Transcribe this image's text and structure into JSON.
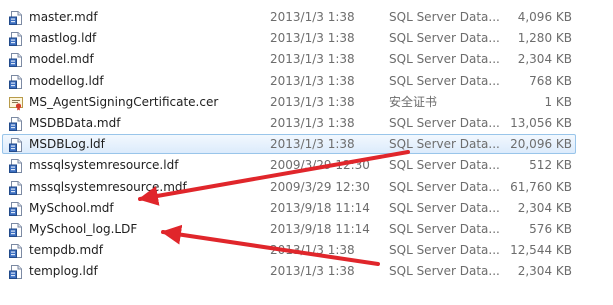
{
  "files": [
    {
      "name": "master.mdf",
      "date": "2013/1/3 1:38",
      "type": "SQL Server Data...",
      "size": "4,096 KB",
      "icon": "sql-data-file-icon"
    },
    {
      "name": "mastlog.ldf",
      "date": "2013/1/3 1:38",
      "type": "SQL Server Data...",
      "size": "1,280 KB",
      "icon": "sql-data-file-icon"
    },
    {
      "name": "model.mdf",
      "date": "2013/1/3 1:38",
      "type": "SQL Server Data...",
      "size": "2,304 KB",
      "icon": "sql-data-file-icon"
    },
    {
      "name": "modellog.ldf",
      "date": "2013/1/3 1:38",
      "type": "SQL Server Data...",
      "size": "768 KB",
      "icon": "sql-data-file-icon"
    },
    {
      "name": "MS_AgentSigningCertificate.cer",
      "date": "2013/1/3 1:38",
      "type": "安全证书",
      "size": "1 KB",
      "icon": "certificate-icon"
    },
    {
      "name": "MSDBData.mdf",
      "date": "2013/1/3 1:38",
      "type": "SQL Server Data...",
      "size": "13,056 KB",
      "icon": "sql-data-file-icon"
    },
    {
      "name": "MSDBLog.ldf",
      "date": "2013/1/3 1:38",
      "type": "SQL Server Data...",
      "size": "20,096 KB",
      "icon": "sql-data-file-icon",
      "selected": true
    },
    {
      "name": "mssqlsystemresource.ldf",
      "date": "2009/3/29 12:30",
      "type": "SQL Server Data...",
      "size": "512 KB",
      "icon": "sql-data-file-icon"
    },
    {
      "name": "mssqlsystemresource.mdf",
      "date": "2009/3/29 12:30",
      "type": "SQL Server Data...",
      "size": "61,760 KB",
      "icon": "sql-data-file-icon"
    },
    {
      "name": "MySchool.mdf",
      "date": "2013/9/18 11:14",
      "type": "SQL Server Data...",
      "size": "2,304 KB",
      "icon": "sql-data-file-icon"
    },
    {
      "name": "MySchool_log.LDF",
      "date": "2013/9/18 11:14",
      "type": "SQL Server Data...",
      "size": "576 KB",
      "icon": "sql-data-file-icon"
    },
    {
      "name": "tempdb.mdf",
      "date": "2013/1/3 1:38",
      "type": "SQL Server Data...",
      "size": "12,544 KB",
      "icon": "sql-data-file-icon"
    },
    {
      "name": "templog.ldf",
      "date": "2013/1/3 1:38",
      "type": "SQL Server Data...",
      "size": "2,304 KB",
      "icon": "sql-data-file-icon"
    }
  ],
  "annotations": {
    "arrow_color": "#e0262b",
    "targets": [
      "MySchool.mdf",
      "MySchool_log.LDF"
    ]
  },
  "colors": {
    "selection_fill": "#dcebfc",
    "selection_border": "#99c5ea",
    "secondary_text": "#6d6d6d"
  }
}
